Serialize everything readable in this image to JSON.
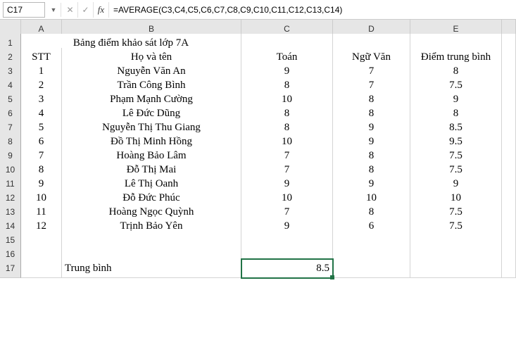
{
  "namebox": "C17",
  "formula": "=AVERAGE(C3,C4,C5,C6,C7,C8,C9,C10,C11,C12,C13,C14)",
  "fx_label": "fx",
  "columns": [
    "A",
    "B",
    "C",
    "D",
    "E"
  ],
  "row_labels": [
    "1",
    "2",
    "3",
    "4",
    "5",
    "6",
    "7",
    "8",
    "9",
    "10",
    "11",
    "12",
    "13",
    "14",
    "15",
    "16",
    "17"
  ],
  "title": "Bảng điểm khảo sát lớp 7A",
  "headers": {
    "stt": "STT",
    "name": "Họ và tên",
    "math": "Toán",
    "lit": "Ngữ Văn",
    "avg": "Điểm trung bình"
  },
  "rows": [
    {
      "stt": "1",
      "name": "Nguyễn Văn An",
      "math": "9",
      "lit": "7",
      "avg": "8"
    },
    {
      "stt": "2",
      "name": "Trần Công Bình",
      "math": "8",
      "lit": "7",
      "avg": "7.5"
    },
    {
      "stt": "3",
      "name": "Phạm Mạnh Cường",
      "math": "10",
      "lit": "8",
      "avg": "9"
    },
    {
      "stt": "4",
      "name": "Lê Đức Dũng",
      "math": "8",
      "lit": "8",
      "avg": "8"
    },
    {
      "stt": "5",
      "name": "Nguyễn Thị Thu Giang",
      "math": "8",
      "lit": "9",
      "avg": "8.5"
    },
    {
      "stt": "6",
      "name": "Đồ Thị Minh Hồng",
      "math": "10",
      "lit": "9",
      "avg": "9.5"
    },
    {
      "stt": "7",
      "name": "Hoàng Bảo Lâm",
      "math": "7",
      "lit": "8",
      "avg": "7.5"
    },
    {
      "stt": "8",
      "name": "Đỗ Thị Mai",
      "math": "7",
      "lit": "8",
      "avg": "7.5"
    },
    {
      "stt": "9",
      "name": "Lê Thị Oanh",
      "math": "9",
      "lit": "9",
      "avg": "9"
    },
    {
      "stt": "10",
      "name": "Đỗ Đức Phúc",
      "math": "10",
      "lit": "10",
      "avg": "10"
    },
    {
      "stt": "11",
      "name": "Hoàng Ngọc Quỳnh",
      "math": "7",
      "lit": "8",
      "avg": "7.5"
    },
    {
      "stt": "12",
      "name": "Trịnh Bảo Yên",
      "math": "9",
      "lit": "6",
      "avg": "7.5"
    }
  ],
  "footer": {
    "label": "Trung bình",
    "value": "8.5"
  },
  "selected_cell": "C17"
}
